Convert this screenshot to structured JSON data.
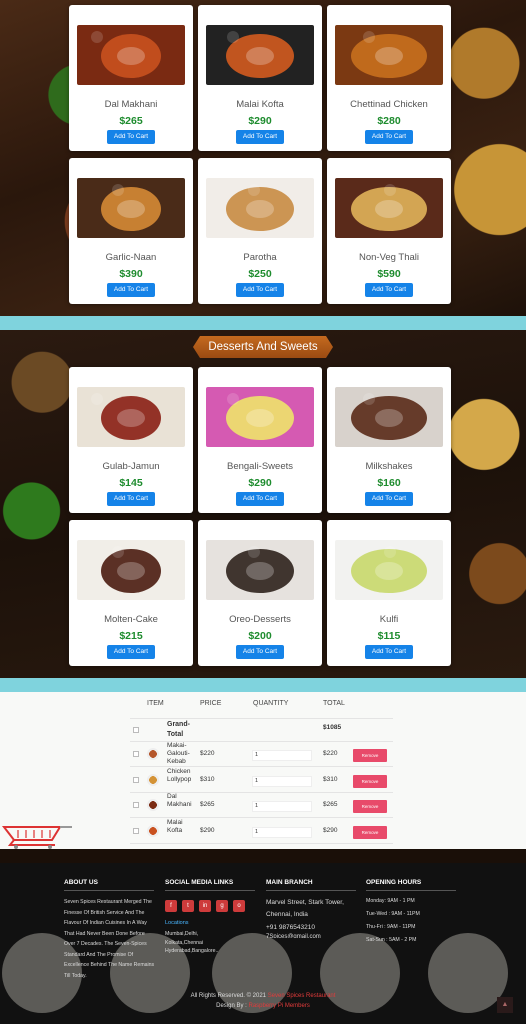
{
  "main_course": {
    "items": [
      {
        "name": "Dal Makhani",
        "price": "$265",
        "button": "Add To Cart",
        "colors": [
          "#7a2a12",
          "#c9511f"
        ]
      },
      {
        "name": "Malai Kofta",
        "price": "$290",
        "button": "Add To Cart",
        "colors": [
          "#222",
          "#d35b1f"
        ]
      },
      {
        "name": "Chettinad Chicken",
        "price": "$280",
        "button": "Add To Cart",
        "colors": [
          "#7b3912",
          "#c8701e"
        ]
      },
      {
        "name": "Garlic-Naan",
        "price": "$390",
        "button": "Add To Cart",
        "colors": [
          "#4a2b18",
          "#d58a35"
        ]
      },
      {
        "name": "Parotha",
        "price": "$250",
        "button": "Add To Cart",
        "colors": [
          "#f1ede8",
          "#c88b43"
        ]
      },
      {
        "name": "Non-Veg Thali",
        "price": "$590",
        "button": "Add To Cart",
        "colors": [
          "#5a2a1a",
          "#e0b25a"
        ]
      }
    ]
  },
  "desserts": {
    "title": "Desserts And Sweets",
    "items": [
      {
        "name": "Gulab-Jamun",
        "price": "$145",
        "button": "Add To Cart",
        "colors": [
          "#e9e2d6",
          "#8a1f14"
        ]
      },
      {
        "name": "Bengali-Sweets",
        "price": "$290",
        "button": "Add To Cart",
        "colors": [
          "#d55ab2",
          "#eee36a"
        ]
      },
      {
        "name": "Milkshakes",
        "price": "$160",
        "button": "Add To Cart",
        "colors": [
          "#d8d2cc",
          "#5a2a18"
        ]
      },
      {
        "name": "Molten-Cake",
        "price": "$215",
        "button": "Add To Cart",
        "colors": [
          "#f1eee8",
          "#4a1b10"
        ]
      },
      {
        "name": "Oreo-Desserts",
        "price": "$200",
        "button": "Add To Cart",
        "colors": [
          "#e6e2de",
          "#2d221c"
        ]
      },
      {
        "name": "Kulfi",
        "price": "$115",
        "button": "Add To Cart",
        "colors": [
          "#f2f2f0",
          "#c8d86a"
        ]
      }
    ]
  },
  "cart": {
    "headers": {
      "item": "ITEM",
      "price": "PRICE",
      "quantity": "QUANTITY",
      "total": "TOTAL"
    },
    "grand_total_label": "Grand-Total",
    "grand_total": "$1085",
    "remove_label": "Remove",
    "rows": [
      {
        "name": "Makai-Galouti-Kebab",
        "price": "$220",
        "qty": "1",
        "total": "$220"
      },
      {
        "name": "Chicken Lollypop",
        "price": "$310",
        "qty": "1",
        "total": "$310"
      },
      {
        "name": "Dal Makhani",
        "price": "$265",
        "qty": "1",
        "total": "$265"
      },
      {
        "name": "Malai Kofta",
        "price": "$290",
        "qty": "1",
        "total": "$290"
      }
    ]
  },
  "footer": {
    "about_title": "ABOUT US",
    "about_text": "Seven Spices Restaurant Merged The Finesse Of British Service And The Flavour Of Indian Cuisines In A Way That Had Never Been Done Before Over 7 Decades. The Seven-Spices Standard And The Promise Of Excellence Behind The Name Remains Till Today.",
    "social_title": "SOCIAL MEDIA LINKS",
    "social_icons": [
      "f",
      "t",
      "in",
      "g",
      "o"
    ],
    "locations_label": "Locations",
    "locations_text": "Mumbai,Delhi, Kolkata,Chennai Hyderabad,Bangalore..",
    "branch_title": "MAIN BRANCH",
    "branch_address": "Marvel Street, Stark Tower, Chennai, India",
    "branch_phone": "+91 9876543210",
    "branch_email": "7Spices@gmail.com",
    "hours_title": "OPENING HOURS",
    "hours": [
      "Monday: 9AM - 1 PM",
      "Tue-Wed : 9AM - 11PM",
      "Thu-Fri : 9AM - 11PM",
      "Sat-Sun : 5AM - 2 PM"
    ],
    "copyright_prefix": "All Rights Reserved. © 2021",
    "copyright_brand": "Seven Spices Restaurant",
    "design_prefix": "Design By :",
    "design_brand": "Raspberry Pi Members",
    "to_top_icon": "arrow-up-icon"
  }
}
